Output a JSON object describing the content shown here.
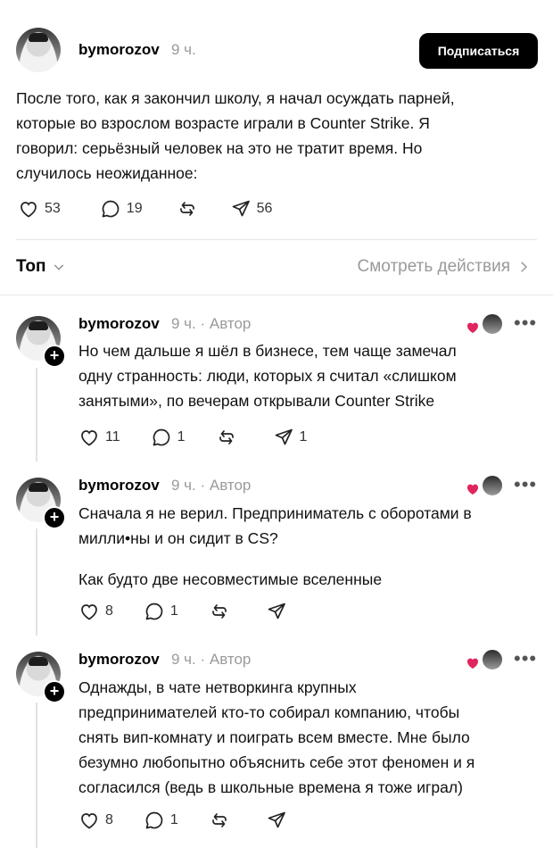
{
  "post": {
    "username": "bymorozov",
    "time": "9 ч.",
    "subscribe_label": "Подписаться",
    "text_lines": [
      "После того, как я закончил школу, я начал осуждать парней,",
      "которые во взрослом возрасте играли в Counter Strike. Я",
      "говорил: серьёзный человек на это не тратит время. Но",
      "случилось неожиданное:"
    ],
    "likes": "53",
    "replies": "19",
    "shares": "56"
  },
  "filter": {
    "sort_label": "Топ",
    "view_actions_label": "Смотреть действия"
  },
  "comments": [
    {
      "username": "bymorozov",
      "meta": "9 ч. · Автор",
      "paragraphs": [
        [
          "Но чем дальше я шёл в бизнесе, тем чаще замечал",
          "одну странность: люди, которых я считал «слишком",
          "занятыми», по вечерам открывали Counter Strike"
        ]
      ],
      "likes": "11",
      "replies": "1",
      "shares": "1"
    },
    {
      "username": "bymorozov",
      "meta": "9 ч. · Автор",
      "paragraphs": [
        [
          "Сначала я не верил. Предприниматель с оборотами в",
          "милли•ны и он сидит в CS?"
        ],
        [
          "Как будто две несовместимые вселенные"
        ]
      ],
      "likes": "8",
      "replies": "1",
      "shares": ""
    },
    {
      "username": "bymorozov",
      "meta": "9 ч. · Автор",
      "paragraphs": [
        [
          "Однажды, в чате нетворкинга крупных",
          "предпринимателей кто-то собирал компанию, чтобы",
          "снять вип-комнату и поиграть всем вместе. Мне было",
          "безумно любопытно объяснить себе этот феномен и я",
          "согласился (ведь в школьные времена я тоже играл)"
        ]
      ],
      "likes": "8",
      "replies": "1",
      "shares": ""
    }
  ],
  "colors": {
    "heart": "#e0245e",
    "muted": "#9a9a9a",
    "divider": "#e6e6e6"
  },
  "icons": [
    "heart-icon",
    "comment-icon",
    "repost-icon",
    "share-icon",
    "chevron-down-icon",
    "chevron-right-icon",
    "more-icon",
    "plus-icon"
  ]
}
